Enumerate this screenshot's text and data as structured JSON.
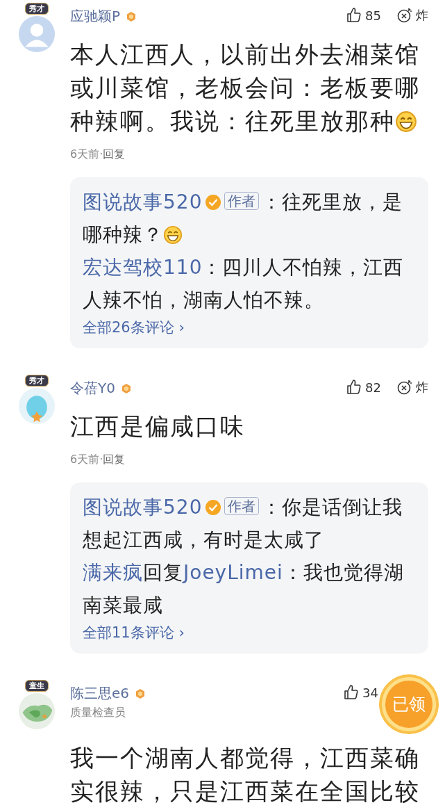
{
  "comments": [
    {
      "avatar": {
        "kind": "default"
      },
      "badge": "秀才",
      "name": "应驰颖P",
      "likes": "85",
      "bomb_label": "炸",
      "body": "本人江西人，以前出外去湘菜馆或川菜馆，老板会问：老板要哪种辣啊。我说：往死里放那种",
      "emoji": true,
      "time": "6天前",
      "separator": "·",
      "reply_label": "回复",
      "replies": [
        {
          "author": "图说故事520",
          "verified": true,
          "author_tag": "作者",
          "text": "：往死里放，是哪种辣？",
          "emoji": true
        },
        {
          "author": "宏达驾校110",
          "text": "：四川人不怕辣，江西人辣不怕，湖南人怕不辣。"
        }
      ],
      "more": "全部26条评论 ›"
    },
    {
      "avatar": {
        "kind": "cartoon"
      },
      "badge": "秀才",
      "name": "令蓓Y0",
      "likes": "82",
      "bomb_label": "炸",
      "body": "江西是偏咸口味",
      "time": "6天前",
      "separator": "·",
      "reply_label": "回复",
      "replies": [
        {
          "author": "图说故事520",
          "verified": true,
          "author_tag": "作者",
          "text": "：你是话倒让我想起江西咸，有时是太咸了"
        },
        {
          "author": "满来疯",
          "reply_word": "回复",
          "reply_to": "JoeyLimei",
          "text": "：我也觉得湖南菜最咸"
        }
      ],
      "more": "全部11条评论 ›"
    },
    {
      "avatar": {
        "kind": "map"
      },
      "badge": "童生",
      "name": "陈三思e6",
      "title": "质量检查员",
      "likes": "34",
      "body": "我一个湖南人都觉得，江西菜确实很辣，只是江西菜在全国比较"
    }
  ],
  "floating_button": "已领"
}
